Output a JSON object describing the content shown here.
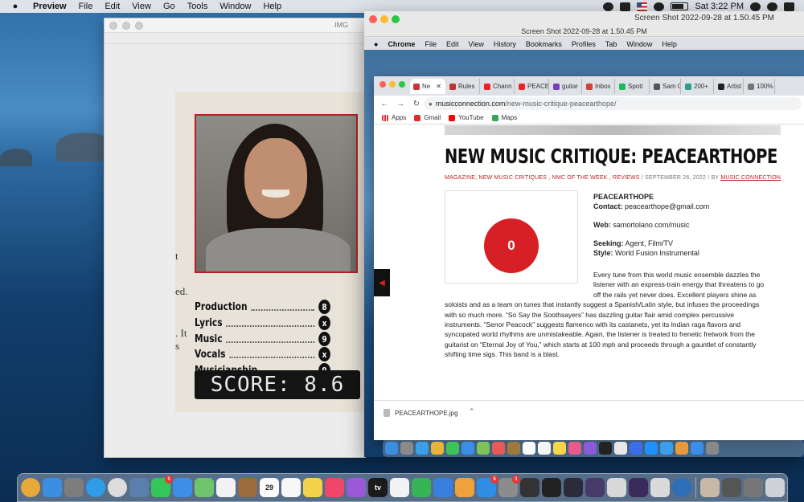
{
  "menubar": {
    "app": "Preview",
    "items": [
      "File",
      "Edit",
      "View",
      "Go",
      "Tools",
      "Window",
      "Help"
    ],
    "clock": "Sat 3:22 PM"
  },
  "preview_window": {
    "title": "IMG",
    "magazine": {
      "edge_chars": [
        "t",
        "ed.",
        ". It",
        "s"
      ],
      "ratings": [
        {
          "label": "Production",
          "score": "8"
        },
        {
          "label": "Lyrics",
          "score": "x"
        },
        {
          "label": "Music",
          "score": "9"
        },
        {
          "label": "Vocals",
          "score": "x"
        },
        {
          "label": "Musicianship",
          "score": "9"
        }
      ],
      "score_display": "SCORE: 8.6"
    }
  },
  "screenshot_window": {
    "title": "Screen Shot 2022-09-28 at 1.50.45 PM",
    "subtitle": "Screen Shot 2022-09-28 at 1.50.45 PM",
    "inner_menubar": {
      "app": "Chrome",
      "items": [
        "File",
        "Edit",
        "View",
        "History",
        "Bookmarks",
        "Profiles",
        "Tab",
        "Window",
        "Help"
      ]
    },
    "chrome": {
      "tabs": [
        {
          "label": "Ne",
          "icon_color": "#c33"
        },
        {
          "label": "Rules",
          "icon_color": "#b33"
        },
        {
          "label": "Chann",
          "icon_color": "#e22"
        },
        {
          "label": "PEACE",
          "icon_color": "#e22"
        },
        {
          "label": "guitar",
          "icon_color": "#7a3fb8"
        },
        {
          "label": "Inbox",
          "icon_color": "#c43"
        },
        {
          "label": "Spoti",
          "icon_color": "#1db954"
        },
        {
          "label": "Sam C",
          "icon_color": "#555"
        },
        {
          "label": "200+",
          "icon_color": "#2a9d8f"
        },
        {
          "label": "Artist",
          "icon_color": "#222"
        },
        {
          "label": "100%",
          "icon_color": "#777"
        }
      ],
      "url_domain": "musicconnection.com",
      "url_path": "/new-music-critique-peacearthope/",
      "bookmarks": [
        "Apps",
        "Gmail",
        "YouTube",
        "Maps"
      ],
      "article": {
        "headline": "NEW MUSIC CRITIQUE: PEACEARTHOPE",
        "categories": "MAGAZINE, NEW MUSIC CRITIQUES , NMC OF THE WEEK , REVIEWS",
        "date": "SEPTEMBER 26, 2022",
        "by_label": "BY",
        "author": "MUSIC CONNECTION",
        "score_circle": "0",
        "artist": "PEACEARTHOPE",
        "contact_label": "Contact:",
        "contact": "peacearthope@gmail.com",
        "web_label": "Web:",
        "web": "samortolano.com/music",
        "seeking_label": "Seeking:",
        "seeking": "Agent, Film/TV",
        "style_label": "Style:",
        "style": "World Fusion Instrumental",
        "body_lines": [
          "Every tune from this world music ensemble dazzles the",
          "listener with an express-train energy that threatens to go",
          "off the rails yet never does. Excellent players shine as",
          "soloists and as a team on tunes that instantly suggest a Spanish/Latin style, but infuses the proceedings",
          "with so much more. “So Say the Soothsayers” has dazzling guitar flair amid complex percussive",
          "instruments. “Senor Peacock” suggests flamenco with its castanets, yet its  Indian raga flavors and",
          "syncopated world rhythms are unmistakeable. Again, the listener is treated to frenetic fretwork from the",
          "guitarist on “Eternal Joy of You,” which starts at 100 mph and proceeds through a gauntlet of constantly",
          "shifting time sigs.  This band is a blast."
        ]
      },
      "download": {
        "filename": "PEACEARTHOPE.jpg"
      }
    },
    "inner_dock_colors": [
      "#3b8ee0",
      "#8a8a8a",
      "#3a9ee8",
      "#e8b33a",
      "#3ec35a",
      "#3a8ee8",
      "#7cc35a",
      "#e85a5a",
      "#a0783c",
      "#fafafa",
      "#f4f4f4",
      "#f6d54a",
      "#e85a8e",
      "#8a5ad8",
      "#222",
      "#e8e8e8",
      "#3a6ee8",
      "#1e90ff",
      "#3a9ee8",
      "#e89a3a",
      "#3a8ee8",
      "#888"
    ],
    "inner_dock_badges": [
      "28"
    ]
  },
  "dock": {
    "icons": [
      {
        "name": "chrome-old-icon",
        "color": "#e8a93a"
      },
      {
        "name": "finder-icon",
        "color": "#3b8ee0"
      },
      {
        "name": "launchpad-icon",
        "color": "#7d7d7d"
      },
      {
        "name": "safari-icon",
        "color": "#2f9ce8"
      },
      {
        "name": "chrome-icon",
        "color": "#dcdcdc"
      },
      {
        "name": "preview-icon",
        "color": "#5a7fae"
      },
      {
        "name": "messages-icon",
        "color": "#35c659",
        "badge": "1"
      },
      {
        "name": "mail-icon",
        "color": "#3d8ee6"
      },
      {
        "name": "maps-icon",
        "color": "#6fc36a"
      },
      {
        "name": "photos-icon",
        "color": "#f2f2f2"
      },
      {
        "name": "notes-brown-icon",
        "color": "#9b6b3b"
      },
      {
        "name": "calendar-icon",
        "color": "#fafafa",
        "text": "29"
      },
      {
        "name": "reminders-icon",
        "color": "#f7f7f7"
      },
      {
        "name": "stickies-icon",
        "color": "#f4d34a"
      },
      {
        "name": "music-icon",
        "color": "#f0466a"
      },
      {
        "name": "podcasts-icon",
        "color": "#9a5ad8"
      },
      {
        "name": "tv-icon",
        "color": "#1b1b1b",
        "text": "tv"
      },
      {
        "name": "news-icon",
        "color": "#f2f2f2"
      },
      {
        "name": "numbers-icon",
        "color": "#35b556"
      },
      {
        "name": "keynote-icon",
        "color": "#3a7ee0"
      },
      {
        "name": "pages-icon",
        "color": "#f0a23a"
      },
      {
        "name": "appstore-icon",
        "color": "#2e8ee6",
        "badge": "5"
      },
      {
        "name": "system-prefs-icon",
        "color": "#8c8c8c",
        "badge": "1"
      },
      {
        "name": "music-tool-icon",
        "color": "#333"
      },
      {
        "name": "midi-icon",
        "color": "#222"
      },
      {
        "name": "mic-app-icon",
        "color": "#2b2b3b"
      },
      {
        "name": "sound-app-icon",
        "color": "#4a3a6a"
      },
      {
        "name": "pencil-app-icon",
        "color": "#d8d8d8"
      },
      {
        "name": "ableton-icon",
        "color": "#3b2b5b"
      },
      {
        "name": "screen-app-icon",
        "color": "#dadada"
      },
      {
        "name": "quicktime-icon",
        "color": "#2f6eb8"
      },
      {
        "name": "separator"
      },
      {
        "name": "doc-thumb-icon",
        "color": "#c8b8a8"
      },
      {
        "name": "screenshot-thumb-icon",
        "color": "#555"
      },
      {
        "name": "screenshot-thumb2-icon",
        "color": "#777"
      },
      {
        "name": "trash-icon",
        "color": "#cfd3d8"
      }
    ]
  }
}
